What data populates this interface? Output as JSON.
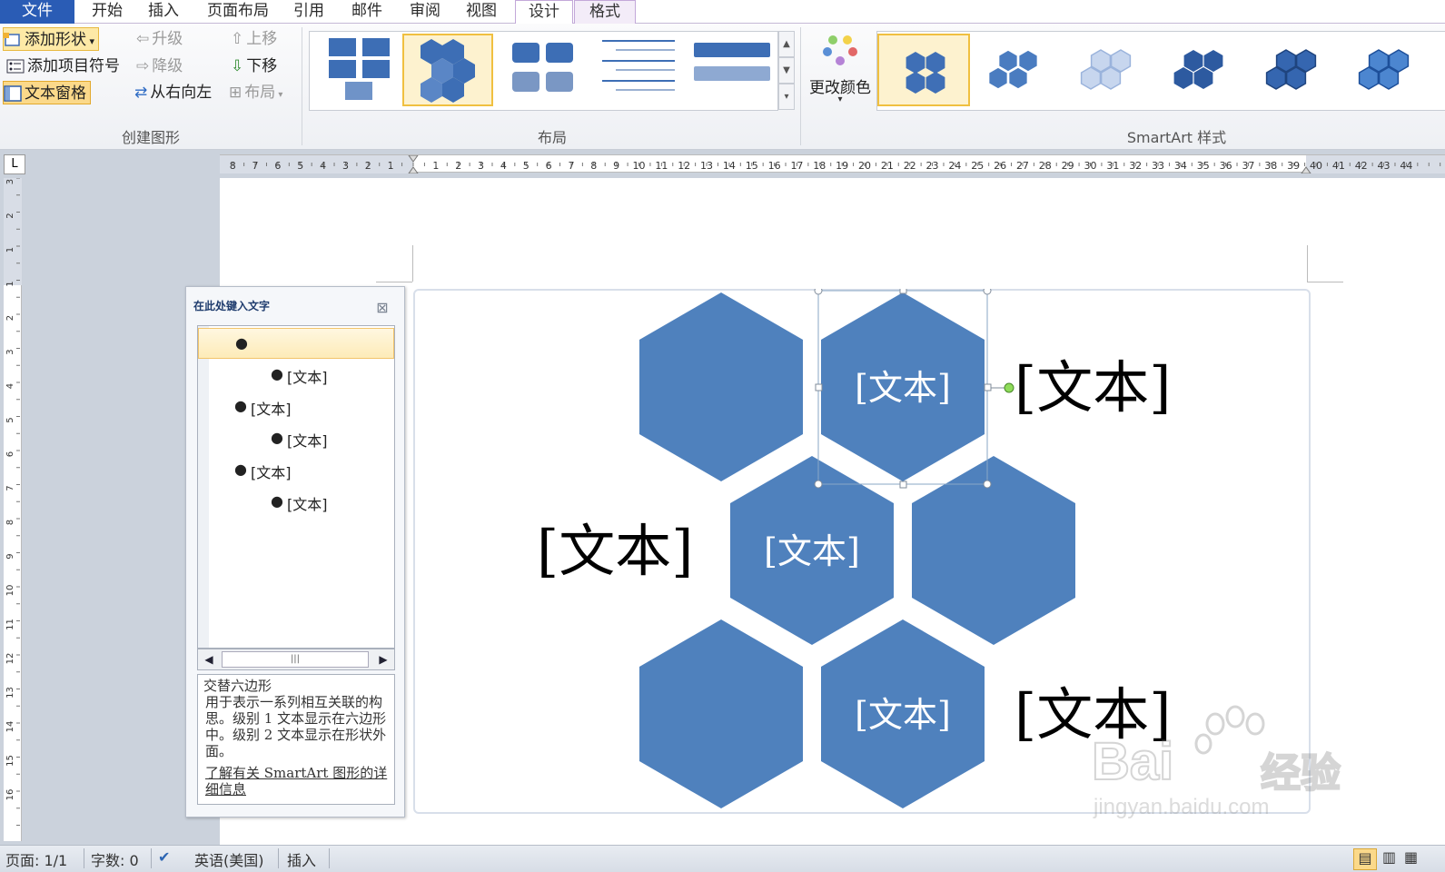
{
  "tabs": [
    {
      "label": "文件"
    },
    {
      "label": "开始"
    },
    {
      "label": "插入"
    },
    {
      "label": "页面布局"
    },
    {
      "label": "引用"
    },
    {
      "label": "邮件"
    },
    {
      "label": "审阅"
    },
    {
      "label": "视图"
    },
    {
      "label": "设计"
    },
    {
      "label": "格式"
    }
  ],
  "ribbon": {
    "create_graphic": {
      "group_label": "创建图形",
      "add_shape": "添加形状",
      "add_bullet": "添加项目符号",
      "text_pane": "文本窗格",
      "promote": "升级",
      "demote": "降级",
      "right_to_left": "从右向左",
      "move_up": "上移",
      "move_down": "下移",
      "layout": "布局"
    },
    "layouts": {
      "group_label": "布局"
    },
    "styles": {
      "group_label": "SmartArt 样式",
      "change_colors": "更改颜色"
    }
  },
  "ruler": {
    "left_numbers": [
      "8",
      "7",
      "6",
      "5",
      "4",
      "3",
      "2",
      "1"
    ],
    "right_numbers": [
      "1",
      "2",
      "3",
      "4",
      "5",
      "6",
      "7",
      "8",
      "9",
      "10",
      "11",
      "12",
      "13",
      "14",
      "15",
      "16",
      "17",
      "18",
      "19",
      "20",
      "21",
      "22",
      "23",
      "24",
      "25",
      "26",
      "27",
      "28",
      "29",
      "30",
      "31",
      "32",
      "33",
      "34",
      "35",
      "36",
      "37",
      "38",
      "39",
      "40",
      "41",
      "42",
      "43",
      "44"
    ],
    "vertical_numbers": [
      "3",
      "2",
      "1",
      "1",
      "2",
      "3",
      "4",
      "5",
      "6",
      "7",
      "8",
      "9",
      "10",
      "11",
      "12",
      "13",
      "14",
      "15",
      "16"
    ]
  },
  "text_pane": {
    "title": "在此处键入文字",
    "items": [
      {
        "level": 1,
        "text": ""
      },
      {
        "level": 2,
        "text": "[文本]"
      },
      {
        "level": 1,
        "text": "[文本]"
      },
      {
        "level": 2,
        "text": "[文本]"
      },
      {
        "level": 1,
        "text": "[文本]"
      },
      {
        "level": 2,
        "text": "[文本]"
      }
    ],
    "desc_title": "交替六边形",
    "desc_body": "用于表示一系列相互关联的构思。级别 1 文本显示在六边形中。级别 2 文本显示在形状外面。",
    "desc_link": "了解有关 SmartArt 图形的详细信息"
  },
  "smartart": {
    "hex_color": "#4f81bd",
    "hex_labels": [
      "[文本]",
      "[文本]",
      "[文本]"
    ],
    "outer_labels": [
      "[文本]",
      "[文本]",
      "[文本]"
    ]
  },
  "status": {
    "page": "页面: 1/1",
    "words": "字数: 0",
    "language": "英语(美国)",
    "mode": "插入"
  },
  "watermark": {
    "brand": "Bai",
    "brand2": "经验",
    "url": "jingyan.baidu.com"
  }
}
